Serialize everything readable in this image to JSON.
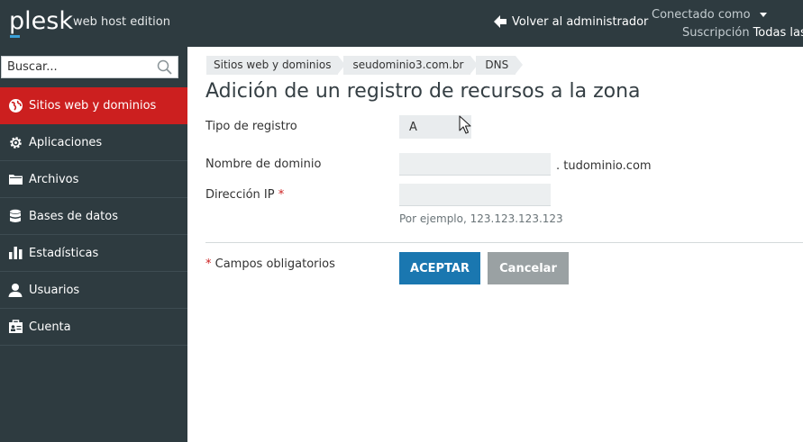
{
  "header": {
    "logo": "plesk",
    "edition": "web host edition",
    "back_label": "Volver al administrador",
    "connected_label": "Conectado como",
    "subscription_label": "Suscripción",
    "subscription_value": "Todas las"
  },
  "sidebar": {
    "search_placeholder": "Buscar...",
    "items": [
      {
        "label": "Sitios web y dominios",
        "icon": "globe-icon",
        "active": true
      },
      {
        "label": "Aplicaciones",
        "icon": "gear-icon",
        "active": false
      },
      {
        "label": "Archivos",
        "icon": "folder-icon",
        "active": false
      },
      {
        "label": "Bases de datos",
        "icon": "database-icon",
        "active": false
      },
      {
        "label": "Estadísticas",
        "icon": "bar-chart-icon",
        "active": false
      },
      {
        "label": "Usuarios",
        "icon": "user-icon",
        "active": false
      },
      {
        "label": "Cuenta",
        "icon": "account-card-icon",
        "active": false
      }
    ]
  },
  "breadcrumb": [
    "Sitios web y dominios",
    "seudominio3.com.br",
    "DNS"
  ],
  "page_title": "Adición de un registro de recursos a la zona",
  "form": {
    "record_type_label": "Tipo de registro",
    "record_type_value": "A",
    "domain_name_label": "Nombre de dominio",
    "domain_name_value": "",
    "domain_suffix": ". tudominio.com",
    "ip_label": "Dirección IP",
    "ip_required_mark": "*",
    "ip_value": "",
    "ip_hint": "Por ejemplo, 123.123.123.123",
    "required_mark": "*",
    "required_note": "Campos obligatorios",
    "ok_label": "ACEPTAR",
    "cancel_label": "Cancelar"
  },
  "colors": {
    "header_bg": "#2e3b40",
    "active_nav": "#cc1f1f",
    "primary_button": "#1a77b0",
    "cancel_button": "#9aa1a3"
  }
}
